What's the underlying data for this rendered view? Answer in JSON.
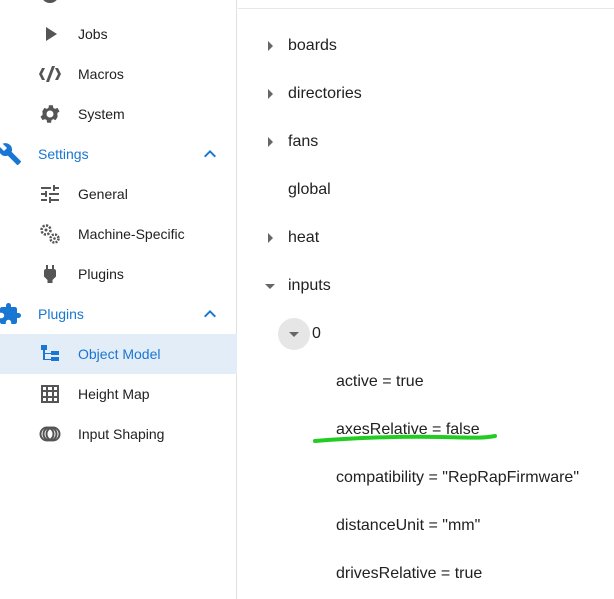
{
  "sidebar": {
    "items": [
      {
        "label": "Jobs",
        "icon": "play-icon"
      },
      {
        "label": "Macros",
        "icon": "code-icon"
      },
      {
        "label": "System",
        "icon": "gear-icon"
      },
      {
        "label": "Settings",
        "icon": "wrench-icon",
        "section": true
      },
      {
        "label": "General",
        "icon": "sliders-icon"
      },
      {
        "label": "Machine-Specific",
        "icon": "gears-icon"
      },
      {
        "label": "Plugins",
        "icon": "plug-icon"
      },
      {
        "label": "Plugins",
        "icon": "puzzle-icon",
        "section": true
      },
      {
        "label": "Object Model",
        "icon": "file-tree-icon",
        "active": true
      },
      {
        "label": "Height Map",
        "icon": "grid-icon"
      },
      {
        "label": "Input Shaping",
        "icon": "rings-icon"
      }
    ],
    "accent_color": "#1976d2",
    "active_bg": "#e3edf8"
  },
  "tree": {
    "nodes": [
      {
        "label": "boards",
        "expandable": true,
        "expanded": false
      },
      {
        "label": "directories",
        "expandable": true,
        "expanded": false
      },
      {
        "label": "fans",
        "expandable": true,
        "expanded": false
      },
      {
        "label": "global",
        "expandable": false
      },
      {
        "label": "heat",
        "expandable": true,
        "expanded": false
      },
      {
        "label": "inputs",
        "expandable": true,
        "expanded": true
      }
    ],
    "child_index": "0",
    "properties": [
      "active = true",
      "axesRelative = false",
      "compatibility = \"RepRapFirmware\"",
      "distanceUnit = \"mm\"",
      "drivesRelative = true"
    ],
    "annotation_color": "#22cc22"
  }
}
